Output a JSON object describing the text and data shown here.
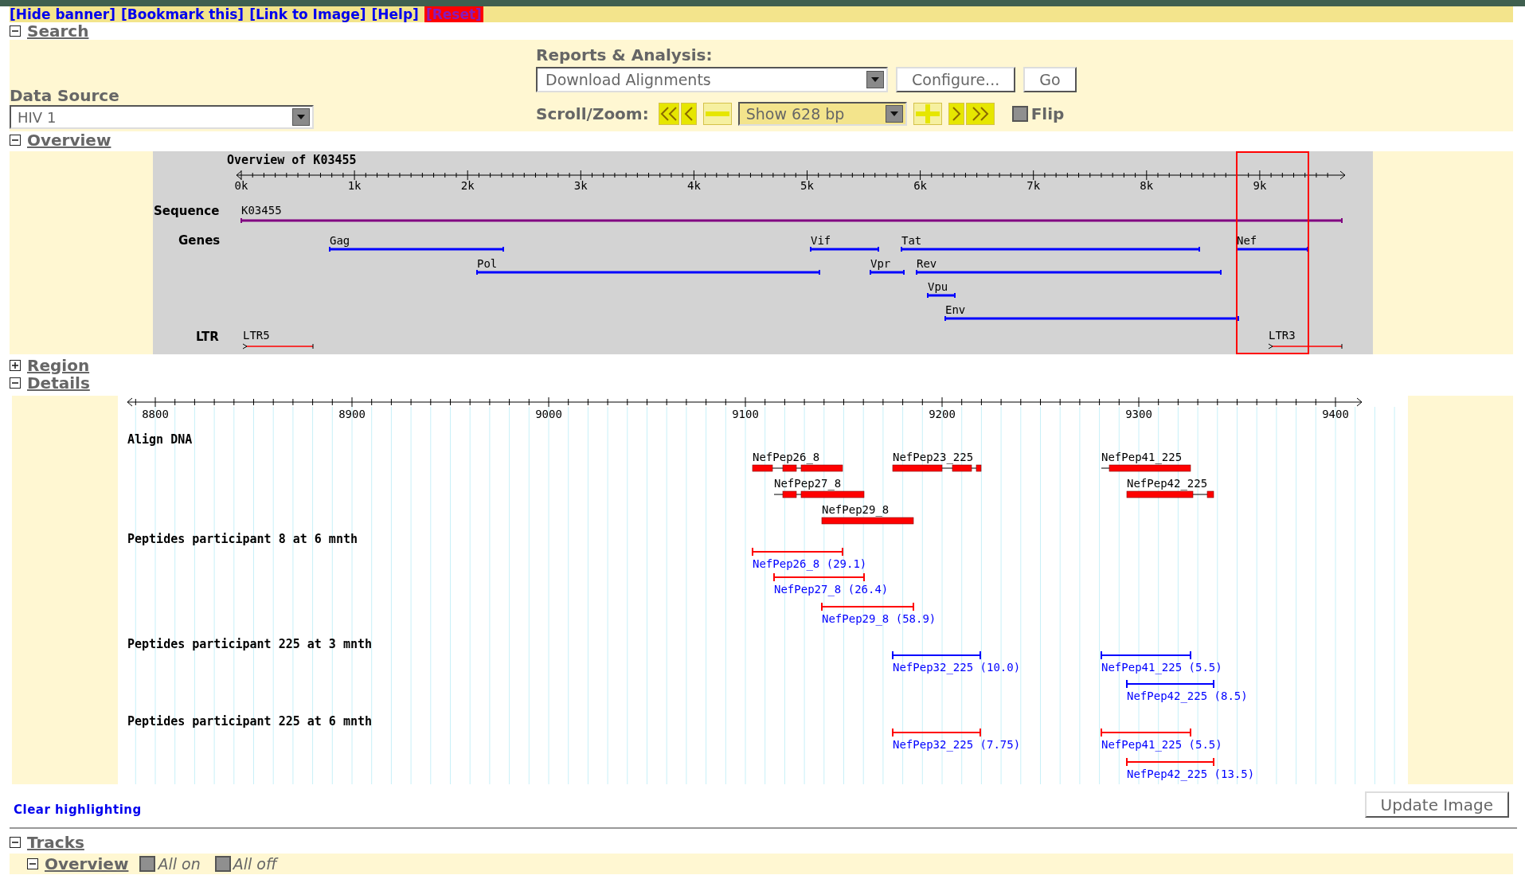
{
  "banner_links": [
    {
      "label": "[Hide banner]",
      "kind": "link"
    },
    {
      "label": "[Bookmark this]",
      "kind": "link"
    },
    {
      "label": "[Link to Image]",
      "kind": "link"
    },
    {
      "label": "[Help]",
      "kind": "link"
    },
    {
      "label": "[Reset]",
      "kind": "reset"
    }
  ],
  "search": {
    "title": "Search",
    "expanded": true,
    "data_source": {
      "label": "Data Source",
      "value": "HIV 1"
    },
    "reports": {
      "label": "Reports & Analysis:",
      "value": "Download Alignments",
      "buttons": [
        "Configure...",
        "Go"
      ]
    },
    "scroll_zoom": {
      "label": "Scroll/Zoom:",
      "value": "Show 628 bp",
      "flip": {
        "label": "Flip",
        "checked": false
      }
    }
  },
  "overview": {
    "title": "Overview",
    "expanded": true,
    "image_title": "Overview of K03455",
    "ticks": [
      "0k",
      "1k",
      "2k",
      "3k",
      "4k",
      "5k",
      "6k",
      "7k",
      "8k",
      "9k"
    ],
    "tracks": [
      {
        "label": "Sequence",
        "kind": "sequence",
        "features": [
          "K03455"
        ]
      },
      {
        "label": "Genes",
        "kind": "genes",
        "features": [
          "Gag",
          "Vif",
          "Tat",
          "Nef",
          "Pol",
          "Vpr",
          "Rev",
          "Vpu",
          "Env"
        ]
      },
      {
        "label": "LTR",
        "kind": "ltr",
        "features": [
          "LTR5",
          "LTR3"
        ]
      }
    ]
  },
  "region": {
    "title": "Region",
    "expanded": false
  },
  "details": {
    "title": "Details",
    "expanded": true,
    "ticks": [
      "8800",
      "8900",
      "9000",
      "9100",
      "9200",
      "9300",
      "9400"
    ],
    "tracks": [
      {
        "label": "Align DNA",
        "kind": "alignment",
        "features": [
          "NefPep26_8",
          "NefPep23_225",
          "NefPep41_225",
          "NefPep27_8",
          "NefPep42_225",
          "NefPep29_8"
        ]
      },
      {
        "label": "Peptides participant 8 at 6 mnth",
        "kind": "peptides",
        "color": "#ff0000",
        "features": [
          "NefPep26_8 (29.1)",
          "NefPep27_8 (26.4)",
          "NefPep29_8 (58.9)"
        ]
      },
      {
        "label": "Peptides participant 225 at 3 mnth",
        "kind": "peptides",
        "color": "#0000ff",
        "features": [
          "NefPep32_225 (10.0)",
          "NefPep41_225 (5.5)",
          "NefPep42_225 (8.5)"
        ]
      },
      {
        "label": "Peptides participant 225 at 6 mnth",
        "kind": "peptides",
        "color": "#ff0000",
        "features": [
          "NefPep32_225 (7.75)",
          "NefPep41_225 (5.5)",
          "NefPep42_225 (13.5)"
        ]
      }
    ]
  },
  "clear_highlighting": "Clear highlighting",
  "update_button": "Update Image",
  "tracks": {
    "title": "Tracks",
    "expanded": true,
    "subsections": [
      {
        "title": "Overview",
        "expanded": true,
        "toggles": [
          {
            "label": "All on",
            "checked": false
          },
          {
            "label": "All off",
            "checked": false
          }
        ]
      }
    ]
  }
}
